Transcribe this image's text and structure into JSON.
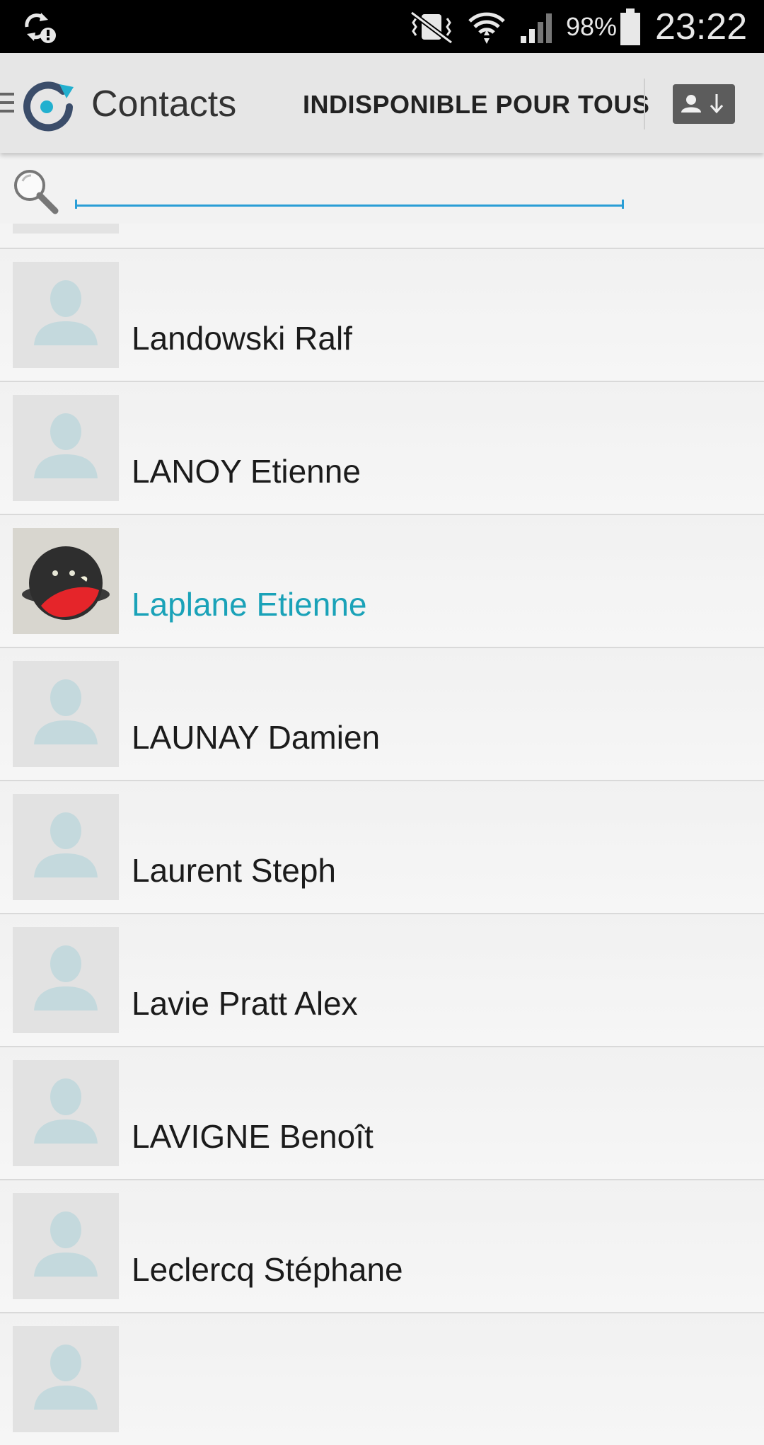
{
  "status_bar": {
    "battery": "98%",
    "time": "23:22"
  },
  "action_bar": {
    "title": "Contacts",
    "presence_status": "INDISPONIBLE POUR TOUS"
  },
  "search": {
    "value": "",
    "placeholder": ""
  },
  "contacts": [
    {
      "name": "Landowski Ralf",
      "highlighted": false,
      "avatar": "default-avatar-icon"
    },
    {
      "name": "LANOY Etienne",
      "highlighted": false,
      "avatar": "default-avatar-icon"
    },
    {
      "name": "Laplane Etienne",
      "highlighted": true,
      "avatar": "custom-photo"
    },
    {
      "name": "LAUNAY Damien",
      "highlighted": false,
      "avatar": "default-avatar-icon"
    },
    {
      "name": "Laurent Steph",
      "highlighted": false,
      "avatar": "default-avatar-icon"
    },
    {
      "name": "Lavie Pratt Alex",
      "highlighted": false,
      "avatar": "default-avatar-icon"
    },
    {
      "name": "LAVIGNE Benoît",
      "highlighted": false,
      "avatar": "default-avatar-icon"
    },
    {
      "name": "Leclercq Stéphane",
      "highlighted": false,
      "avatar": "default-avatar-icon"
    },
    {
      "name": "",
      "highlighted": false,
      "avatar": "default-avatar-icon"
    }
  ],
  "colors": {
    "accent": "#1aa2b8",
    "search_underline": "#2a9ed6",
    "action_bar": "#e6e6e6",
    "status_bar": "#000000"
  }
}
